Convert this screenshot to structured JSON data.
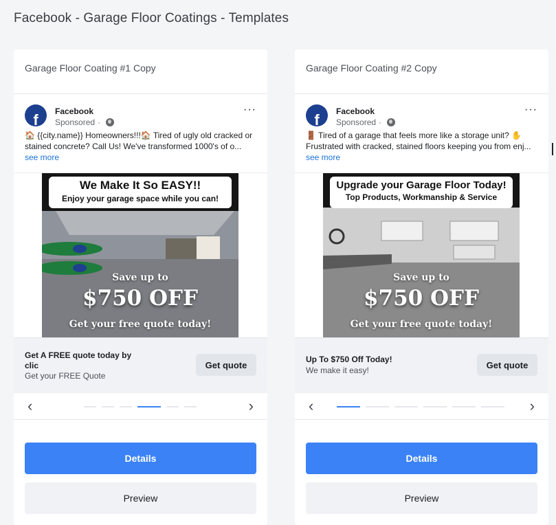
{
  "page": {
    "title": "Facebook - Garage Floor Coatings - Templates"
  },
  "colors": {
    "primary": "#3b82f6",
    "link": "#1b72d9",
    "fb_blue": "#1d3f8f"
  },
  "cards": [
    {
      "name": "Garage Floor Coating #1 Copy",
      "page_name": "Facebook",
      "sponsored": "Sponsored",
      "body_text": "🏠 {{city.name}} Homeowners!!!🏠 Tired of ugly old cracked or stained concrete? Call Us! We've transformed 1000's of o... ",
      "see_more": "see more",
      "image": {
        "headline": "We Make It So EASY!!",
        "subheadline": "Enjoy your garage space while you can!",
        "promo_line1": "Save up to",
        "promo_line2": "$750 OFF",
        "promo_line3": "Get your free quote today!"
      },
      "cta_title": "Get A FREE quote today by clic",
      "cta_desc": "Get your FREE Quote",
      "cta_button": "Get quote",
      "carousel_index": 4,
      "carousel_total": 7,
      "details_label": "Details",
      "preview_label": "Preview"
    },
    {
      "name": "Garage Floor Coating #2 Copy",
      "page_name": "Facebook",
      "sponsored": "Sponsored",
      "body_text": "🚪 Tired of a garage that feels more like a storage unit? ✋ Frustrated with cracked, stained floors keeping you from enj... ",
      "see_more": "see more",
      "image": {
        "headline": "Upgrade your Garage Floor Today!",
        "subheadline": "Top Products, Workmanship & Service",
        "promo_line1": "Save up to",
        "promo_line2": "$750 OFF",
        "promo_line3": "Get your free quote today!"
      },
      "cta_title": "Up To $750 Off Today!",
      "cta_desc": "We make it easy!",
      "cta_button": "Get quote",
      "carousel_index": 1,
      "carousel_total": 6,
      "details_label": "Details",
      "preview_label": "Preview"
    }
  ],
  "icons": {
    "logo": "facebook-logo-icon",
    "globe": "globe-icon",
    "more": "more-options-icon",
    "prev": "chevron-left-icon",
    "next": "chevron-right-icon"
  }
}
